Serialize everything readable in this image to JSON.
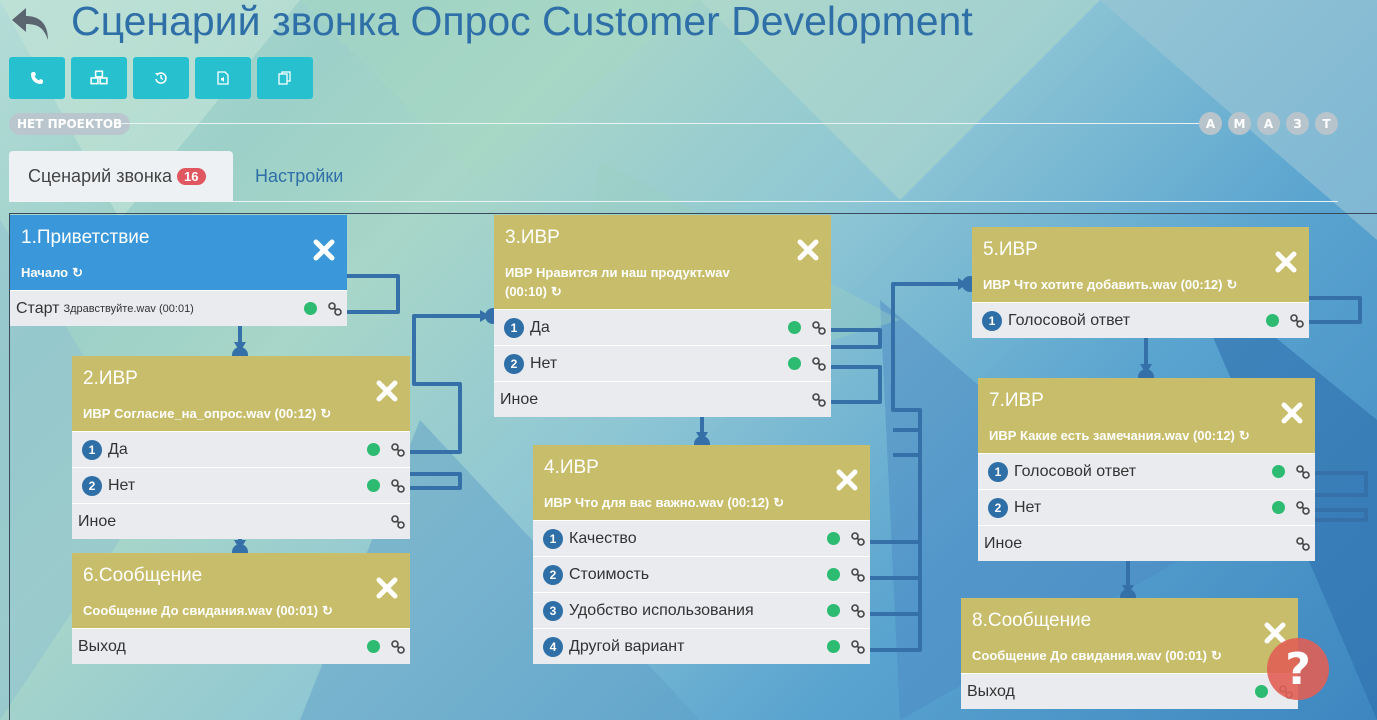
{
  "header": {
    "title": "Сценарий звонка Опрос Customer Development",
    "back_icon": "arrow-back-icon"
  },
  "toolbar": {
    "buttons": [
      {
        "icon": "phone-icon"
      },
      {
        "icon": "cubes-icon"
      },
      {
        "icon": "history-icon"
      },
      {
        "icon": "audio-file-icon"
      },
      {
        "icon": "copy-icon"
      }
    ],
    "color": "#26c0cf"
  },
  "projects": {
    "label": "НЕТ ПРОЕКТОВ"
  },
  "users": [
    "А",
    "М",
    "А",
    "З",
    "Т"
  ],
  "tabs": {
    "scenario": "Сценарий звонка",
    "scenario_count": "16",
    "settings": "Настройки"
  },
  "nodes": {
    "n1": {
      "title": "1.Приветствие",
      "subtitle": "Начало",
      "rows": [
        {
          "label": "Старт",
          "extra": "Здравствуйте.wav (00:01)"
        }
      ]
    },
    "n2": {
      "title": "2.ИВР",
      "subtitle": "ИВР Согласие_на_опрос.wav (00:12)",
      "rows": [
        {
          "num": "1",
          "label": "Да"
        },
        {
          "num": "2",
          "label": "Нет"
        },
        {
          "label": "Иное"
        }
      ]
    },
    "n3": {
      "title": "3.ИВР",
      "subtitle": "ИВР Нравится ли наш продукт.wav (00:10)",
      "rows": [
        {
          "num": "1",
          "label": "Да"
        },
        {
          "num": "2",
          "label": "Нет"
        },
        {
          "label": "Иное"
        }
      ]
    },
    "n4": {
      "title": "4.ИВР",
      "subtitle": "ИВР Что для вас важно.wav (00:12)",
      "rows": [
        {
          "num": "1",
          "label": "Качество"
        },
        {
          "num": "2",
          "label": "Стоимость"
        },
        {
          "num": "3",
          "label": "Удобство использования"
        },
        {
          "num": "4",
          "label": "Другой вариант"
        }
      ]
    },
    "n5": {
      "title": "5.ИВР",
      "subtitle": "ИВР Что хотите добавить.wav (00:12)",
      "rows": [
        {
          "num": "1",
          "label": "Голосовой ответ"
        }
      ]
    },
    "n6": {
      "title": "6.Сообщение",
      "subtitle": "Сообщение До свидания.wav (00:01)",
      "rows": [
        {
          "label": "Выход"
        }
      ]
    },
    "n7": {
      "title": "7.ИВР",
      "subtitle": "ИВР Какие есть замечания.wav (00:12)",
      "rows": [
        {
          "num": "1",
          "label": "Голосовой ответ"
        },
        {
          "num": "2",
          "label": "Нет"
        },
        {
          "label": "Иное"
        }
      ]
    },
    "n8": {
      "title": "8.Сообщение",
      "subtitle": "Сообщение До свидания.wav (00:01)",
      "rows": [
        {
          "label": "Выход"
        }
      ]
    }
  },
  "help": {
    "label": "?"
  },
  "colors": {
    "node_header": "#c7bd6a",
    "start_header": "#3a97d9",
    "wire": "#2f6fa8",
    "accent": "#2f6fa8"
  }
}
